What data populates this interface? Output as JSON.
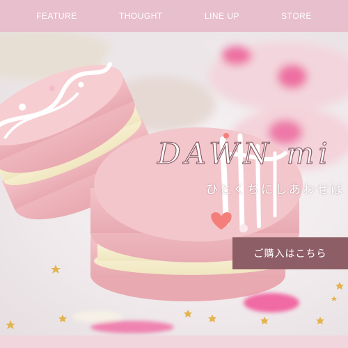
{
  "nav": {
    "items": [
      {
        "label": "FEATURE"
      },
      {
        "label": "THOUGHT"
      },
      {
        "label": "LINE UP"
      },
      {
        "label": "STORE"
      }
    ]
  },
  "hero": {
    "brand": "DAWN mi",
    "tagline": "ひとくちにしあわせは",
    "cta_label": "ご購入はこちら"
  },
  "colors": {
    "nav_bg": "#e8bfcc",
    "cta_bg": "#8e5e67",
    "macaron_pink": "#f0b9bf"
  }
}
